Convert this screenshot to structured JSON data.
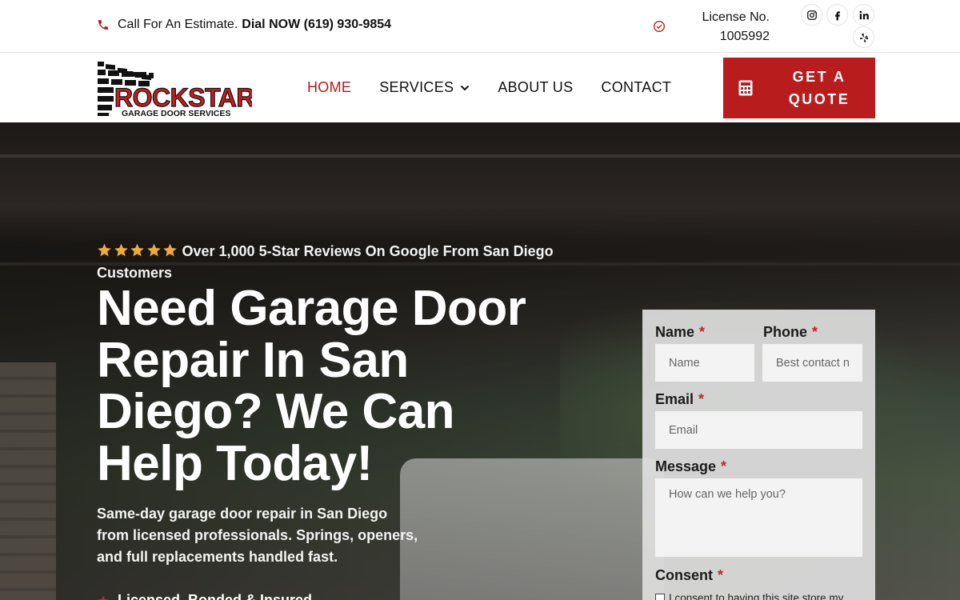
{
  "topbar": {
    "call_prefix": "Call For An Estimate.",
    "call_bold": "Dial NOW (619) 930-9854",
    "license_line1": "License No.",
    "license_line2": "1005992",
    "social_icons": [
      "instagram-icon",
      "facebook-icon",
      "linkedin-icon",
      "yelp-icon"
    ]
  },
  "header": {
    "logo_text_main": "ROCKSTAR",
    "logo_text_sub": "GARAGE DOOR SERVICES",
    "nav": [
      {
        "label": "HOME",
        "active": true
      },
      {
        "label": "SERVICES",
        "dropdown": true
      },
      {
        "label": "ABOUT US"
      },
      {
        "label": "CONTACT"
      }
    ],
    "quote_button_line1": "GET A",
    "quote_button_line2": "QUOTE"
  },
  "hero": {
    "reviews_text": "Over 1,000 5-Star Reviews On Google From San Diego Customers",
    "star_count": 5,
    "headline_lines": [
      "Need Garage Door",
      "Repair In San",
      "Diego? We Can",
      "Help Today!"
    ],
    "subtext_lines": [
      "Same-day garage door repair in San Diego",
      "from licensed professionals. Springs, openers,",
      "and full replacements handled fast."
    ],
    "cutoff_feature": "Licensed, Bonded & Insured"
  },
  "form": {
    "name_label": "Name",
    "name_placeholder": "Name",
    "phone_label": "Phone",
    "phone_placeholder": "Best contact n",
    "email_label": "Email",
    "email_placeholder": "Email",
    "message_label": "Message",
    "message_placeholder": "How can we help you?",
    "consent_label": "Consent",
    "consent_text": "I consent to having this site store my",
    "required_mark": "*"
  },
  "colors": {
    "brand_red": "#b81c1c",
    "nav_active": "#b31a1a",
    "required": "#c0262d",
    "star": "#f2a93b"
  }
}
